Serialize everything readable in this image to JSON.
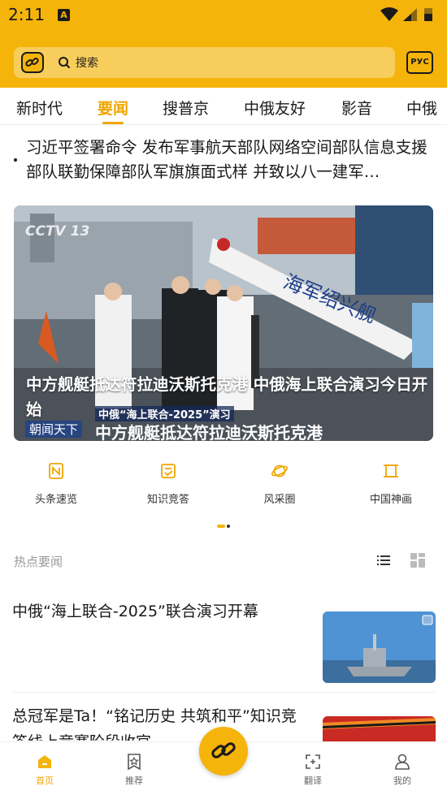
{
  "status_bar": {
    "time": "2:11",
    "notification_icon": "A"
  },
  "search": {
    "placeholder": "搜索",
    "language_button": "РУС"
  },
  "tabs": [
    {
      "label": "新时代",
      "active": false
    },
    {
      "label": "要闻",
      "active": true
    },
    {
      "label": "搜普京",
      "active": false
    },
    {
      "label": "中俄友好",
      "active": false
    },
    {
      "label": "影音",
      "active": false
    },
    {
      "label": "中俄",
      "active": false
    }
  ],
  "headline": {
    "text": "习近平签署命令 发布军事航天部队网络空间部队信息支援部队联勤保障部队军旗旗面式样 并致以八一建军…"
  },
  "banner": {
    "caption": "中方舰艇抵达符拉迪沃斯托克港 中俄海上联合演习今日开始",
    "overlay_subtitle": "中俄“海上联合-2025”演习",
    "overlay_title": "中方舰艇抵达符拉迪沃斯托克港",
    "overlay_tag": "朝闻天下",
    "watermark": "CCTV 13",
    "ship_banner_text": "海军绍兴舰"
  },
  "shortcuts": [
    {
      "label": "头条速览",
      "icon": "newspaper-icon"
    },
    {
      "label": "知识竞答",
      "icon": "quiz-icon"
    },
    {
      "label": "风采圈",
      "icon": "planet-icon"
    },
    {
      "label": "中国神画",
      "icon": "scroll-painting-icon"
    }
  ],
  "section": {
    "title": "热点要闻"
  },
  "news": [
    {
      "title": "中俄“海上联合-2025”联合演习开幕"
    },
    {
      "title": "总冠军是Ta！“铭记历史 共筑和平”知识竞答线上竞赛阶段收官"
    }
  ],
  "bottom_nav": [
    {
      "label": "首页",
      "active": true
    },
    {
      "label": "推荐",
      "active": false
    },
    {
      "label": "翻译",
      "active": false
    },
    {
      "label": "我的",
      "active": false
    }
  ],
  "colors": {
    "brand": "#f5b40a",
    "accent": "#f0a500"
  }
}
